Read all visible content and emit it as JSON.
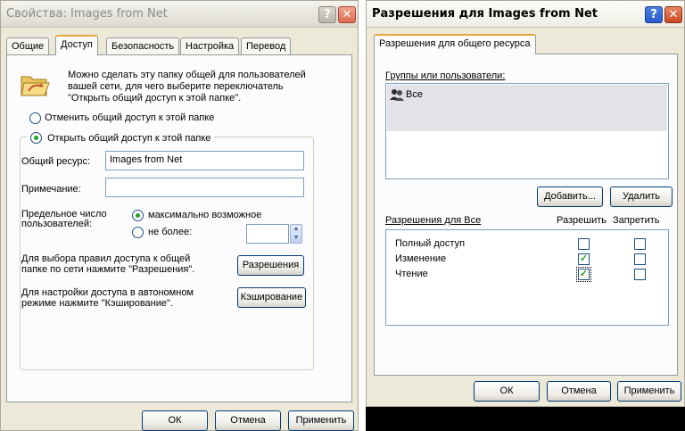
{
  "props_window": {
    "title": "Свойства: Images from Net",
    "tabs": [
      "Общие",
      "Доступ",
      "Безопасность",
      "Настройка",
      "Перевод"
    ],
    "active_tab": "Доступ",
    "info_text_1": "Можно сделать эту папку общей для пользователей",
    "info_text_2": "вашей сети, для чего выберите переключатель",
    "info_text_3": "\"Открыть общий доступ к этой папке\".",
    "radio_no_share": "Отменить общий доступ к этой папке",
    "radio_share": "Открыть общий доступ к этой папке",
    "share_name_label": "Общий ресурс:",
    "share_name_value": "Images from Net",
    "comment_label": "Примечание:",
    "comment_value": "",
    "user_limit_label_1": "Предельное число",
    "user_limit_label_2": "пользователей:",
    "radio_max": "максимально возможное",
    "radio_no_more": "не более:",
    "permissions_text_1": "Для выбора правил доступа к общей",
    "permissions_text_2": "папке по сети нажмите \"Разрешения\".",
    "permissions_button": "Разрешения",
    "caching_text_1": "Для настройки доступа в автономном",
    "caching_text_2": "режиме нажмите \"Кэширование\".",
    "caching_button": "Кэширование",
    "ok_button": "ОК",
    "cancel_button": "Отмена",
    "apply_button": "Применить"
  },
  "perm_window": {
    "title": "Разрешения для Images from Net",
    "tab": "Разрешения для общего ресурса",
    "groups_label": "Группы или пользователи:",
    "groups": [
      "Все"
    ],
    "add_button": "Добавить...",
    "remove_button": "Удалить",
    "permissions_for": "Разрешения для Все",
    "allow_header": "Разрешить",
    "deny_header": "Запретить",
    "permissions": [
      {
        "name": "Полный доступ",
        "allow": false,
        "deny": false
      },
      {
        "name": "Изменение",
        "allow": true,
        "deny": false
      },
      {
        "name": "Чтение",
        "allow": true,
        "deny": false
      }
    ],
    "ok_button": "ОК",
    "cancel_button": "Отмена",
    "apply_button": "Применить"
  },
  "colors": {
    "dialog_bg": "#ece9d8",
    "active_tab_accent": "#e7a43c",
    "check_green": "#21a121",
    "list_selection": "#e2e2e8"
  }
}
